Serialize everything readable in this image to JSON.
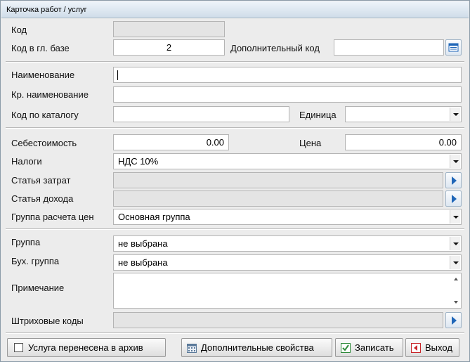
{
  "window": {
    "title": "Карточка работ / услуг"
  },
  "labels": {
    "code": "Код",
    "main_base_code": "Код в гл. базе",
    "additional_code": "Дополнительный код",
    "name": "Наименование",
    "short_name": "Кр. наименование",
    "catalog_code": "Код по каталогу",
    "unit": "Единица",
    "cost_price": "Себестоимость",
    "price": "Цена",
    "taxes": "Налоги",
    "expense_item": "Статья затрат",
    "income_item": "Статья дохода",
    "price_group": "Группа расчета цен",
    "group": "Группа",
    "accounting_group": "Бух. группа",
    "note": "Примечание",
    "barcodes": "Штриховые коды"
  },
  "values": {
    "code": "",
    "main_base_code": "2",
    "additional_code": "",
    "name": "",
    "short_name": "",
    "catalog_code": "",
    "unit": "",
    "cost_price": "0.00",
    "price": "0.00",
    "taxes": "НДС 10%",
    "expense_item": "",
    "income_item": "",
    "price_group": "Основная группа",
    "group": "не выбрана",
    "accounting_group": "не выбрана",
    "note": "",
    "barcodes": ""
  },
  "footer": {
    "archived_checkbox": {
      "label": "Услуга перенесена в архив",
      "checked": false
    },
    "extra_props_button": "Дополнительные свойства",
    "save_button": "Записать",
    "exit_button": "Выход"
  },
  "icons": {
    "lookup": "table-icon",
    "select_arrow": "arrow-right-icon",
    "extra_props": "calendar-grid-icon",
    "save": "save-green-icon",
    "exit": "exit-red-icon"
  },
  "colors": {
    "accent_blue": "#1f66b8",
    "save_green": "#2e8b3a",
    "exit_red": "#c8262a"
  }
}
